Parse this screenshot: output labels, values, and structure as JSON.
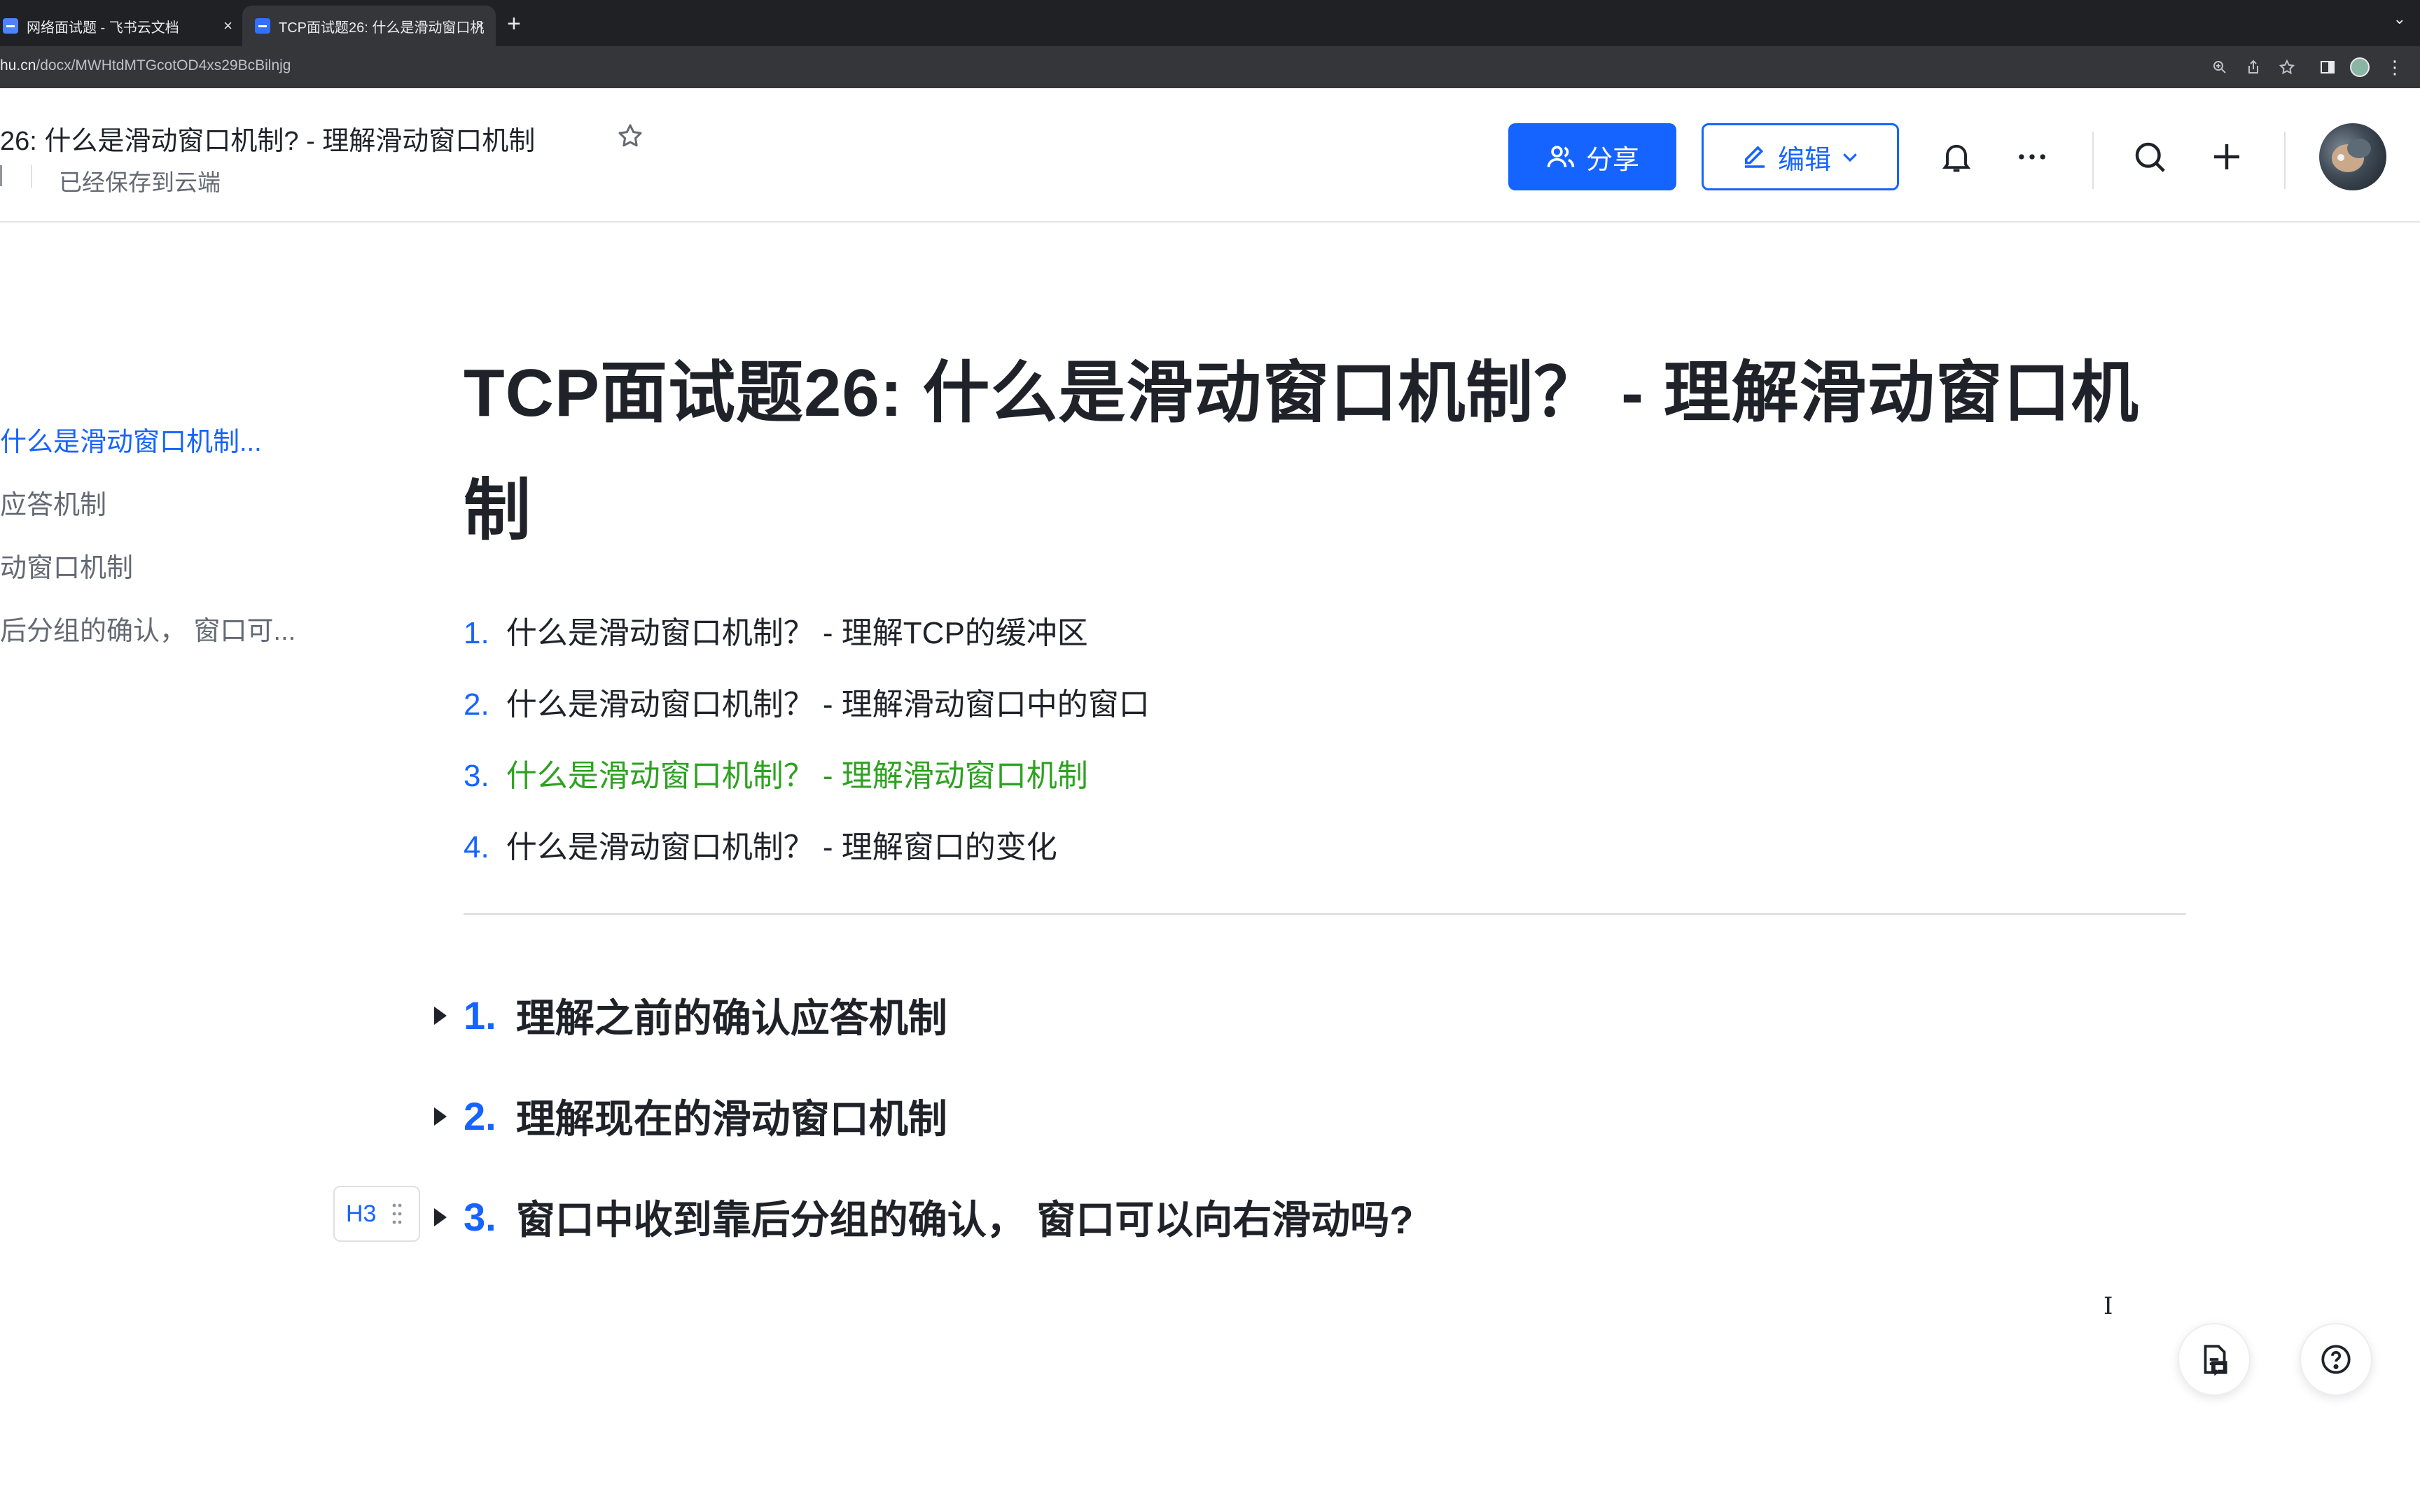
{
  "browser": {
    "tabs": [
      {
        "title": "网络面试题 - 飞书云文档",
        "active": false
      },
      {
        "title": "TCP面试题26: 什么是滑动窗口机",
        "active": true
      }
    ],
    "url_host": "hu.cn",
    "url_path": "/docx/MWHtdMTGcotOD4xs29BcBilnjg"
  },
  "header": {
    "doc_title": "26: 什么是滑动窗口机制?  - 理解滑动窗口机制",
    "saved_text": "已经保存到云端",
    "share_label": "分享",
    "edit_label": "编辑",
    "accent_color": "#1664ff"
  },
  "outline": {
    "items": [
      {
        "label": "什么是滑动窗口机制...",
        "active": true
      },
      {
        "label": "应答机制",
        "active": false
      },
      {
        "label": "动窗口机制",
        "active": false
      },
      {
        "label": "后分组的确认， 窗口可...",
        "active": false
      }
    ]
  },
  "document": {
    "title": "TCP面试题26: 什么是滑动窗口机制？ - 理解滑动窗口机制",
    "toc": [
      {
        "num": "1.",
        "text": "什么是滑动窗口机制？ - 理解TCP的缓冲区",
        "current": false
      },
      {
        "num": "2.",
        "text": "什么是滑动窗口机制？ - 理解滑动窗口中的窗口",
        "current": false
      },
      {
        "num": "3.",
        "text": "什么是滑动窗口机制？ - 理解滑动窗口机制",
        "current": true
      },
      {
        "num": "4.",
        "text": "什么是滑动窗口机制？ - 理解窗口的变化",
        "current": false
      }
    ],
    "sections": [
      {
        "num": "1.",
        "text": "理解之前的确认应答机制"
      },
      {
        "num": "2.",
        "text": "理解现在的滑动窗口机制"
      },
      {
        "num": "3.",
        "text": "窗口中收到靠后分组的确认， 窗口可以向右滑动吗?"
      }
    ],
    "heading_tag": "H3",
    "toc_current_color": "#2ea121"
  },
  "icons": {
    "share": "users-icon",
    "edit": "pencil-icon",
    "notifications": "bell-icon",
    "more": "more-icon",
    "search": "search-icon",
    "add": "plus-icon",
    "favorite": "star-icon",
    "fab_left": "comment-panel-icon",
    "fab_right": "help-icon"
  }
}
